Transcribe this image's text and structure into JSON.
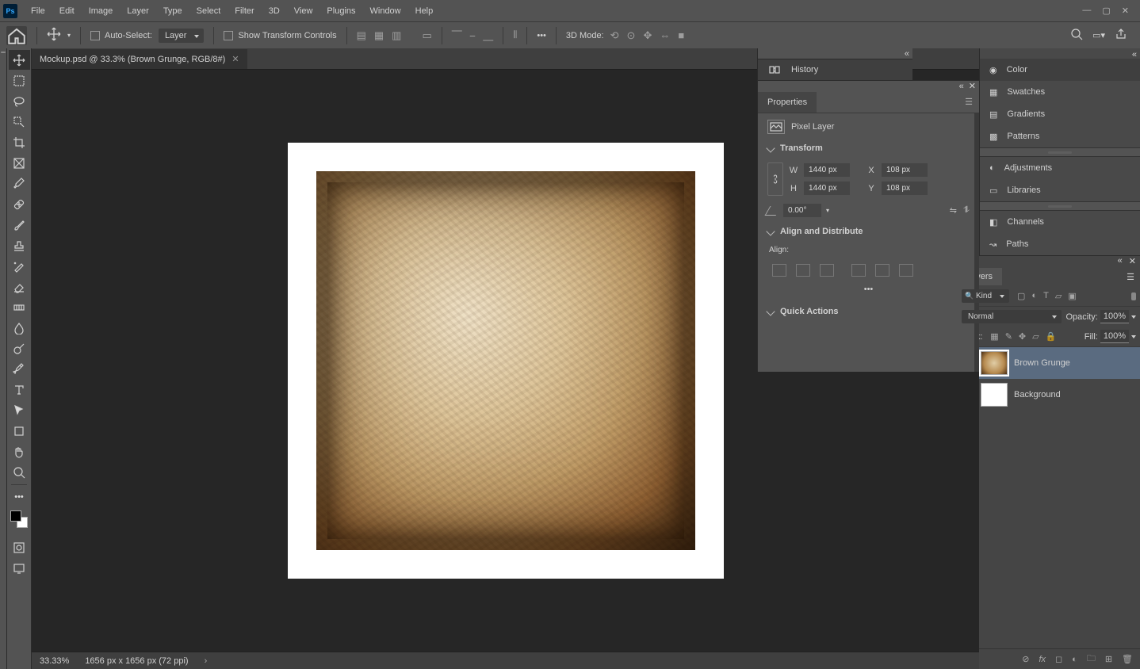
{
  "menu": [
    "File",
    "Edit",
    "Image",
    "Layer",
    "Type",
    "Select",
    "Filter",
    "3D",
    "View",
    "Plugins",
    "Window",
    "Help"
  ],
  "options": {
    "autoSelect": "Auto-Select:",
    "autoSelectTarget": "Layer",
    "showTransform": "Show Transform Controls",
    "mode3d": "3D Mode:"
  },
  "docTab": "Mockup.psd @ 33.3% (Brown Grunge, RGB/8#)",
  "status": {
    "zoom": "33.33%",
    "dims": "1656 px x 1656 px (72 ppi)"
  },
  "historyPanel": {
    "title": "History"
  },
  "properties": {
    "title": "Properties",
    "layerType": "Pixel Layer",
    "transformTitle": "Transform",
    "W": "1440 px",
    "H": "1440 px",
    "X": "108 px",
    "Y": "108 px",
    "angle": "0.00°",
    "alignTitle": "Align and Distribute",
    "alignLabel": "Align:",
    "quickTitle": "Quick Actions"
  },
  "rightTabs": {
    "color": "Color",
    "swatches": "Swatches",
    "gradients": "Gradients",
    "patterns": "Patterns",
    "adjustments": "Adjustments",
    "libraries": "Libraries",
    "channels": "Channels",
    "paths": "Paths"
  },
  "layers": {
    "title": "Layers",
    "kind": "Kind",
    "blend": "Normal",
    "opacityLabel": "Opacity:",
    "opacityVal": "100%",
    "lockLabel": "Lock:",
    "fillLabel": "Fill:",
    "fillVal": "100%",
    "items": [
      {
        "name": "Brown Grunge",
        "selected": true,
        "grunge": true
      },
      {
        "name": "Background",
        "selected": false,
        "grunge": false
      }
    ]
  }
}
